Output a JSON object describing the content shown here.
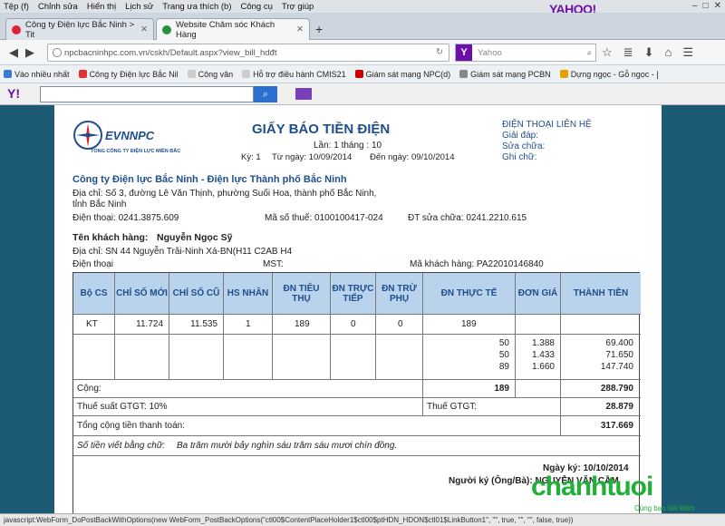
{
  "menu": [
    "Tệp (f)",
    "Chỉnh sửa",
    "Hiển thị",
    "Lịch sử",
    "Trang ưa thích (b)",
    "Công cụ",
    "Trợ giúp"
  ],
  "brand": "YAHOO!",
  "tabs": [
    {
      "label": "Công ty Điện lực Bắc Ninh > Tit"
    },
    {
      "label": "Website Chăm sóc Khách Hàng"
    }
  ],
  "url": "npcbacninhpc.com.vn/cskh/Default.aspx?view_bill_hdđt",
  "search_placeholder": "Yahoo",
  "bookmarks": [
    "Vào nhiều nhất",
    "Công ty Điện lực Bắc Nil",
    "Công văn",
    "Hỗ trợ điều hành CMIS21",
    "Giám sát mạng NPC(d)",
    "Giám sát mạng PCBN",
    "Dựng ngọc - Gỗ ngọc - |"
  ],
  "invoice": {
    "logo_name": "EVNNPC",
    "logo_sub": "TỔNG CÔNG TY ĐIỆN LỰC MIỀN BẮC",
    "title": "GIẤY BÁO TIỀN ĐIỆN",
    "period": "Lần: 1 tháng : 10",
    "ky": "Kỳ: 1",
    "from_date": "Từ ngày: 10/09/2014",
    "to_date": "Đến ngày: 09/10/2014",
    "contact_title": "ĐIỆN THOẠI LIÊN HỆ",
    "contact_lines": [
      "Giải đáp:",
      "Sửa chữa:",
      "Ghi chữ:"
    ],
    "company": "Công ty Điện lực Bắc Ninh - Điện lực Thành phố Bắc Ninh",
    "address_line1": "Địa chỉ: Số 3, đường Lê Văn Thịnh, phường Suối Hoa, thành phố Bắc Ninh,",
    "address_line2": "tỉnh Bắc Ninh",
    "phone": "Điện thoại: 0241.3875.609",
    "tax_code": "Mã số thuế: 0100100417-024",
    "repair_phone": "ĐT sửa chữa: 0241.2210.615",
    "customer_label": "Tên khách hàng:",
    "customer_name": "Nguyễn Ngọc Sỹ",
    "customer_address": "Địa chỉ: SN 44 Nguyễn Trãi-Ninh Xá-BN(H11 C2AB H4",
    "customer_phone": "Điện thoại",
    "mst": "MST:",
    "customer_code": "Mã khách hàng: PA22010146840",
    "headers": [
      "Bộ CS",
      "CHỈ SỐ MỚI",
      "CHỈ SỐ CŨ",
      "HS NHÂN",
      "ĐN TIÊU THỤ",
      "ĐN TRỰC TIẾP",
      "ĐN TRỪ PHỤ",
      "ĐN THỰC TẾ",
      "ĐƠN GIÁ",
      "THÀNH TIỀN"
    ],
    "meter_row": {
      "bo_cs": "KT",
      "moi": "11.724",
      "cu": "11.535",
      "hs": "1",
      "tieu_thu": "189",
      "truc_tiep": "0",
      "tru_phu": "0",
      "thuc_te": "189"
    },
    "tiers": [
      {
        "kwh": "50",
        "price": "1.388",
        "amount": "69.400"
      },
      {
        "kwh": "50",
        "price": "1.433",
        "amount": "71.650"
      },
      {
        "kwh": "89",
        "price": "1.660",
        "amount": "147.740"
      }
    ],
    "total_label": "Cộng:",
    "total_kwh": "189",
    "total_amount": "288.790",
    "vat_rate": "Thuế suất GTGT: 10%",
    "vat_label": "Thuế GTGT:",
    "vat_amount": "28.879",
    "grand_label": "Tổng cộng tiền thanh toán:",
    "grand_total": "317.669",
    "words_label": "Số tiền viết bằng chữ:",
    "words": "Ba trăm mười bảy nghìn sáu trăm sáu mươi chín đồng.",
    "sign_date": "Ngày ký: 10/10/2014",
    "signer": "Người ký (Ông/Bà): NGUYỄN VĂN CẦM"
  },
  "status_text": "javascript:WebForm_DoPostBackWithOptions(new WebForm_PostBackOptions(\"ctl00$ContentPlaceHolder1$ctl00$ptHDN_HDON$ctl01$LinkButton1\", \"\", true, \"\", \"\", false, true))",
  "watermark": "chanhtuoi",
  "watermark_tag": "Cùng bạn tiết kiệm"
}
